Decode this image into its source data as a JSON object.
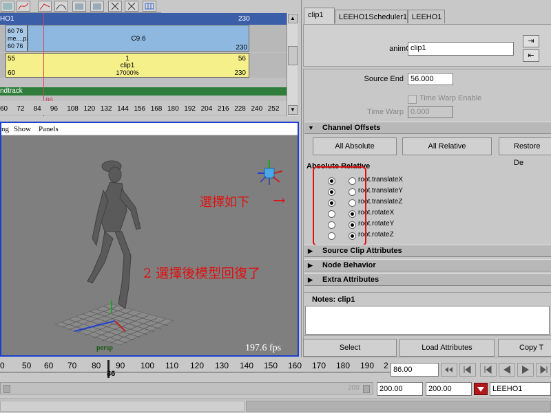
{
  "trax": {
    "track_name": "HO1",
    "rows": [
      {
        "start": "60",
        "end": "230",
        "clip_label": "C9.6",
        "left_lines": [
          "60  76",
          "me....p2",
          "60  76"
        ]
      },
      {
        "start": "55",
        "end": "56",
        "start2": "60",
        "end2": "230",
        "clip_num": "1",
        "clip_name": "clip1",
        "clip_scale": "17000%"
      }
    ],
    "soundtrack_label": "ndtrack",
    "current_frame": "86",
    "ruler": [
      "60",
      "72",
      "84",
      "96",
      "108",
      "120",
      "132",
      "144",
      "156",
      "168",
      "180",
      "192",
      "204",
      "216",
      "228",
      "240",
      "252"
    ]
  },
  "viewport": {
    "menu": [
      "ng",
      "Show",
      "Panels"
    ],
    "camera_label": "persp",
    "fps": "197.6 fps"
  },
  "annotations": {
    "select_note": "選擇如下",
    "arrow": "→",
    "result_note": "2 選擇後模型回復了"
  },
  "timeline": {
    "ticks": [
      "0",
      "50",
      "60",
      "70",
      "80",
      "90",
      "100",
      "110",
      "120",
      "130",
      "140",
      "150",
      "160",
      "170",
      "180",
      "190",
      "2"
    ],
    "current": "86",
    "current_field": "86.00"
  },
  "range": {
    "end_dim": "200",
    "start_field": "200.00",
    "end_field": "200.00",
    "character": "LEEHO1"
  },
  "attribute_editor": {
    "tabs": [
      "clip1",
      "LEEHO1Scheduler1",
      "LEEHO1"
    ],
    "anim_clip_label": "animClip:",
    "anim_clip_value": "clip1",
    "source_end_label": "Source End",
    "source_end_value": "56.000",
    "time_warp_enable_label": "Time Warp Enable",
    "time_warp_label": "Time Warp",
    "time_warp_value": "0.000",
    "sections": {
      "channel_offsets": "Channel Offsets",
      "source_clip": "Source Clip Attributes",
      "node_behavior": "Node Behavior",
      "extra": "Extra Attributes"
    },
    "buttons": [
      "All Absolute",
      "All Relative",
      "Restore De"
    ],
    "abs_rel_header": "Absolute Relative",
    "channels": [
      {
        "name": "root.translateX",
        "absolute": true
      },
      {
        "name": "root.translateY",
        "absolute": true
      },
      {
        "name": "root.translateZ",
        "absolute": true
      },
      {
        "name": "root.rotateX",
        "absolute": false
      },
      {
        "name": "root.rotateY",
        "absolute": false
      },
      {
        "name": "root.rotateZ",
        "absolute": false
      }
    ],
    "notes_label": "Notes:  clip1",
    "bottom_buttons": [
      "Select",
      "Load Attributes",
      "Copy T"
    ]
  }
}
